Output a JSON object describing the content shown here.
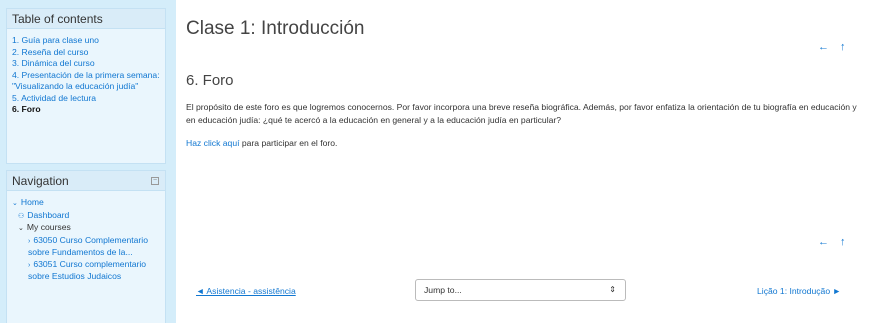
{
  "toc": {
    "title": "Table of contents",
    "items": [
      {
        "label": "1. Guía para clase uno",
        "active": false
      },
      {
        "label": "2. Reseña del curso",
        "active": false
      },
      {
        "label": "3. Dinámica del curso",
        "active": false
      },
      {
        "label": "4. Presentación de la primera semana: \"Visualizando la educación judía\"",
        "active": false
      },
      {
        "label": "5. Actividad de lectura",
        "active": false
      },
      {
        "label": "6. Foro",
        "active": true
      }
    ]
  },
  "nav": {
    "title": "Navigation",
    "collapse_icon": "−",
    "home": "Home",
    "dashboard": "Dashboard",
    "my_courses": "My courses",
    "course1": "63050 Curso Complementario sobre Fundamentos de la...",
    "course2": "63051 Curso complementario sobre Estudios Judaicos"
  },
  "main": {
    "page_title": "Clase 1: Introducción",
    "section_title": "6. Foro",
    "paragraph": "El propósito de este foro es que logremos conocernos. Por favor incorpora una breve reseña biográfica. Además, por favor enfatiza la orientación de tu biografía en educación y en educación judía: ¿qué te acercó a la educación en general y a la educación judía en particular?",
    "link_text": "Haz click aquí",
    "link_suffix": " para participar en el foro.",
    "nav_arrows": "← ↑"
  },
  "footer": {
    "prev": "◄ Asistencia - assistência",
    "jump": "Jump to...",
    "jump_caret": "⇕",
    "next": "Lição 1: Introdução ►"
  }
}
